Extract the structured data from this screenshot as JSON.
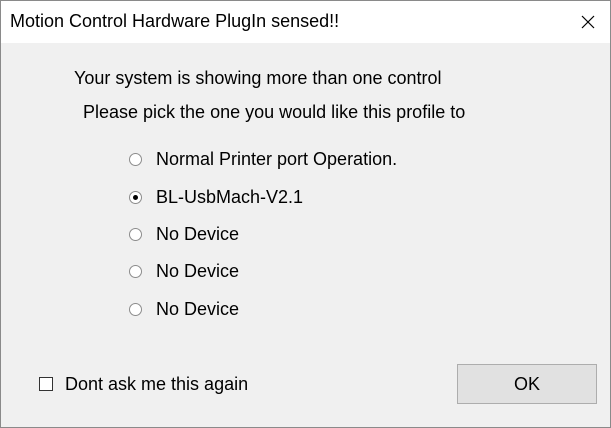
{
  "window": {
    "title": "Motion Control Hardware PlugIn sensed!!",
    "close_icon": "close-icon"
  },
  "message": {
    "line1": "Your system is showing more than one control",
    "line2": "Please pick the one you would like this profile to"
  },
  "devices": [
    {
      "label": "Normal Printer port Operation.",
      "selected": false
    },
    {
      "label": "BL-UsbMach-V2.1",
      "selected": true
    },
    {
      "label": "No Device",
      "selected": false
    },
    {
      "label": "No Device",
      "selected": false
    },
    {
      "label": "No Device",
      "selected": false
    }
  ],
  "dont_ask": {
    "label": "Dont ask me this again",
    "checked": false
  },
  "ok_button": {
    "label": "OK"
  }
}
